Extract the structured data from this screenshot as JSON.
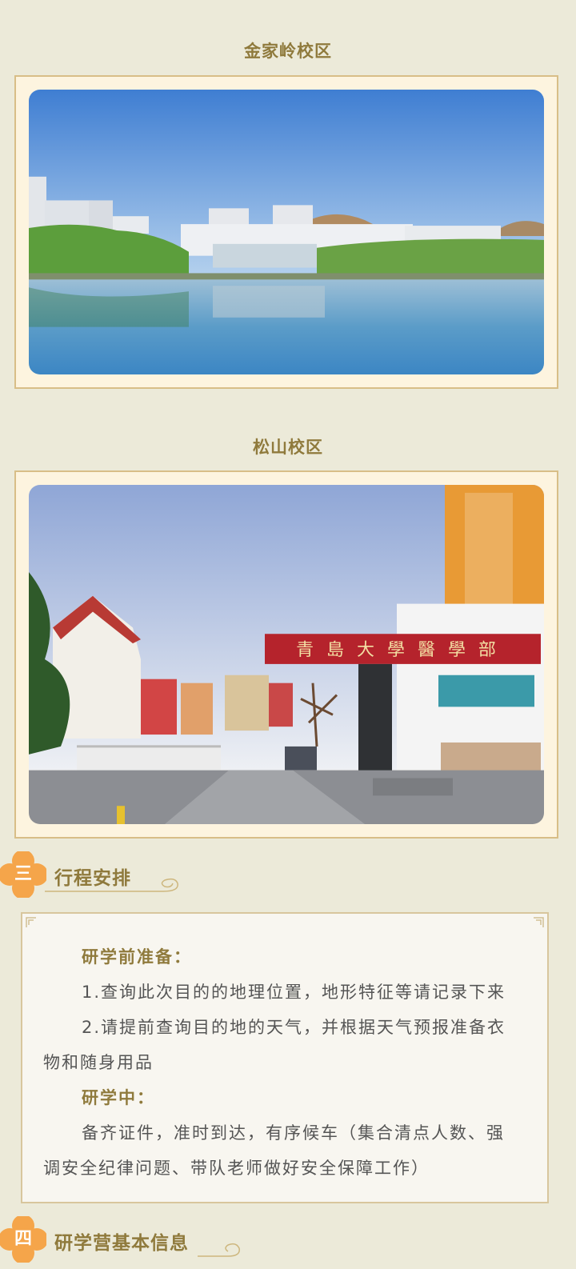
{
  "campus1": {
    "title": "金家岭校区"
  },
  "campus2": {
    "title": "松山校区"
  },
  "photo2": {
    "sign": "青島大學醫學部"
  },
  "section3": {
    "number": "三",
    "title": "行程安排"
  },
  "schedule": {
    "prep_heading": "研学前准备：",
    "prep_item1": "1.查询此次目的的地理位置，地形特征等请记录下来",
    "prep_item2_a": "2.请提前查询目的地的天气，并根据天气预报准备衣",
    "prep_item2_b": "物和随身用品",
    "during_heading": "研学中：",
    "during_text_a": "备齐证件，准时到达，有序候车（集合清点人数、强",
    "during_text_b": "调安全纪律问题、带队老师做好安全保障工作）"
  },
  "section4": {
    "number": "四",
    "title": "研学营基本信息"
  },
  "colors": {
    "accent": "#f5a54a",
    "title": "#8f7a3c",
    "frame": "#d8be87"
  }
}
